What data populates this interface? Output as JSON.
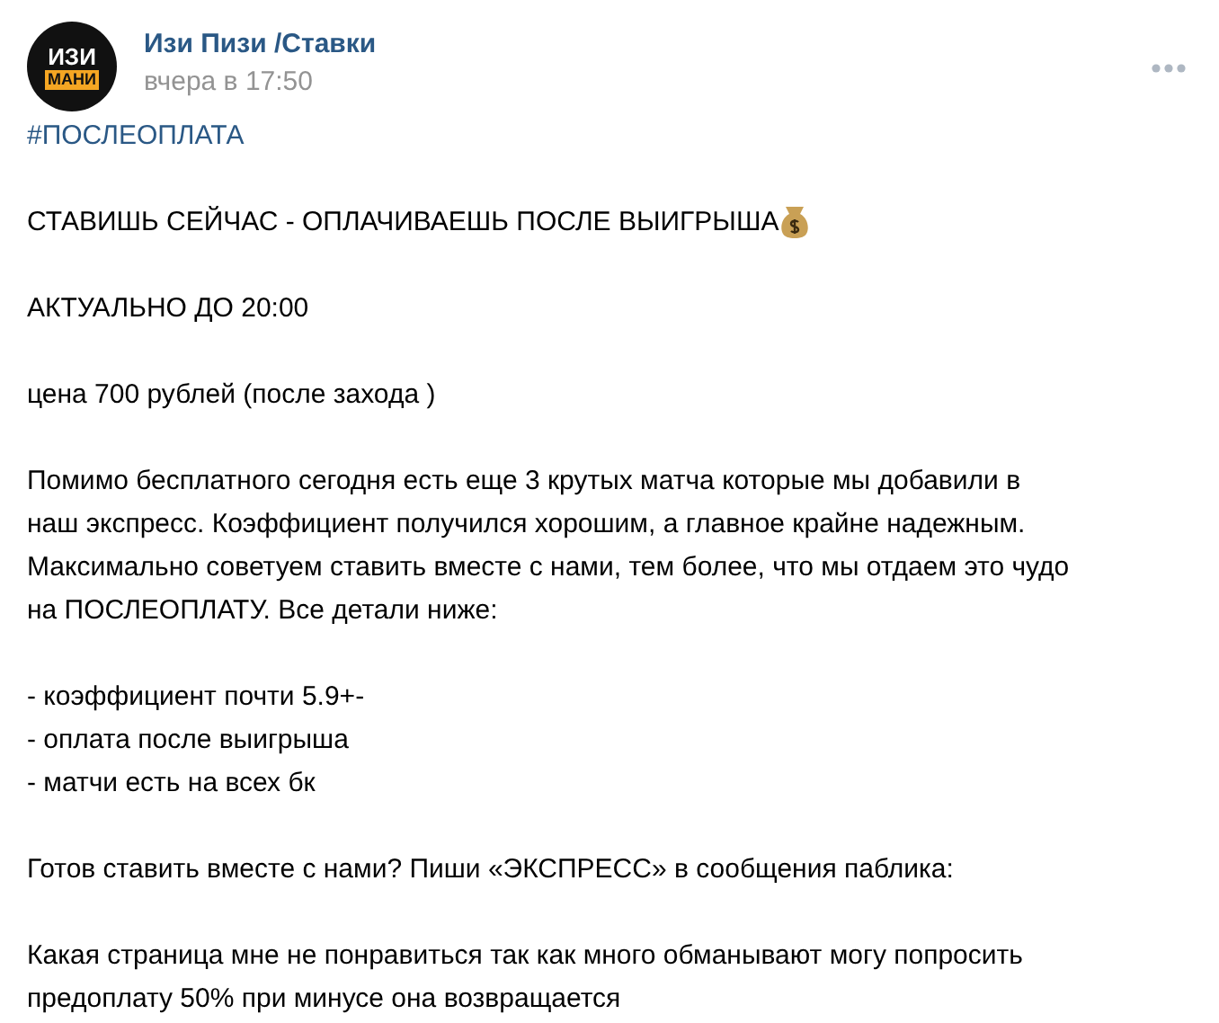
{
  "post": {
    "avatar": {
      "top": "ИЗИ",
      "bottom": "МАНИ"
    },
    "author": "Изи Пизи /Ставки",
    "time": "вчера в 17:50",
    "hashtag": "#ПОСЛЕОПЛАТА",
    "paragraphs": [
      {
        "lines": [
          "СТАВИШЬ СЕЙЧАС - ОПЛАЧИВАЕШЬ ПОСЛЕ ВЫИГРЫША"
        ],
        "emoji": true
      },
      {
        "lines": [
          "АКТУАЛЬНО ДО 20:00"
        ],
        "emoji": false
      },
      {
        "lines": [
          "цена 700 рублей (после захода )"
        ],
        "emoji": false
      },
      {
        "lines": [
          "Помимо бесплатного сегодня есть еще 3 крутых матча которые мы добавили в",
          "наш экспресс. Коэффициент получился хорошим, а главное крайне надежным.",
          "Максимально советуем ставить вместе с нами, тем более, что мы отдаем это чудо",
          "на ПОСЛЕОПЛАТУ. Все детали ниже:"
        ],
        "emoji": false
      },
      {
        "lines": [
          "- коэффициент почти 5.9+-",
          "- оплата после выигрыша",
          "- матчи есть на всех бк"
        ],
        "emoji": false
      },
      {
        "lines": [
          "Готов ставить вместе с нами? Пиши «ЭКСПРЕСС» в сообщения паблика:"
        ],
        "emoji": false
      },
      {
        "lines": [
          "Какая страница мне не понравиться так как много обманывают могу попросить",
          "предоплату 50% при минусе она возвращается"
        ],
        "emoji": false
      }
    ]
  }
}
